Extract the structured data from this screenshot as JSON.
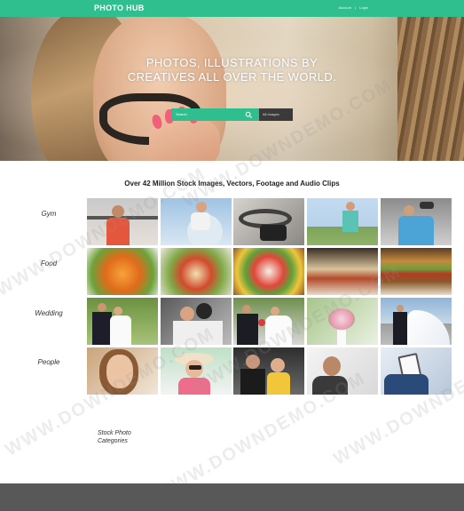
{
  "header": {
    "logo": "PHOTO HUB",
    "links": [
      "Account",
      "Login"
    ]
  },
  "hero": {
    "title_line1": "PHOTOS, ILLUSTRATIONS BY",
    "title_line2": "CREATIVES ALL OVER THE WORLD.",
    "search_placeholder": "Search",
    "search_scope": "All Images",
    "icon": "search-icon"
  },
  "main": {
    "section_title": "Over 42 Million Stock Images, Vectors, Footage and Audio Clips",
    "categories": [
      {
        "label": "Gym",
        "tiles": [
          "woman lifting weights",
          "woman on exercise ball",
          "gym machine close-up",
          "woman standing outdoors",
          "woman with dumbbell"
        ]
      },
      {
        "label": "Food",
        "tiles": [
          "salad with vegetables",
          "salad plate",
          "vegetable platter",
          "open sandwiches",
          "burger"
        ]
      },
      {
        "label": "Wedding",
        "tiles": [
          "bride and groom",
          "couple embracing",
          "groom with bride",
          "bridal bouquet",
          "couple walking"
        ]
      },
      {
        "label": "People",
        "tiles": [
          "smiling woman",
          "woman with hat",
          "happy couple",
          "man on phone",
          "person with tablet"
        ]
      }
    ]
  },
  "stock_categories": {
    "title_line1": "Stock Photo",
    "title_line2": "Categories"
  },
  "watermark": "WWW.DOWNDEMO.COM",
  "colors": {
    "brand": "#2fbf8e",
    "footer": "#585858"
  }
}
